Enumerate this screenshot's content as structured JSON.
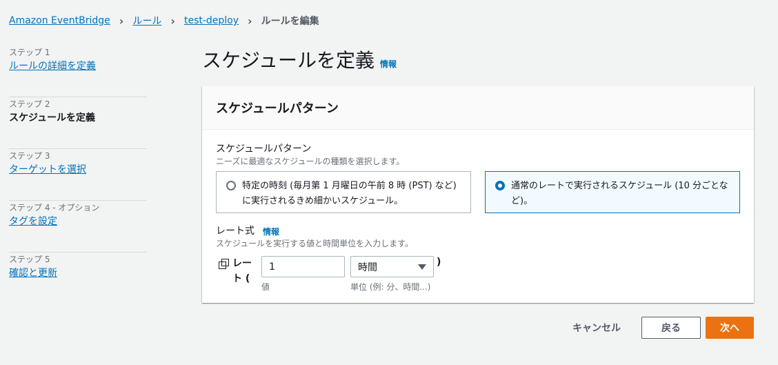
{
  "breadcrumb": {
    "items": [
      "Amazon EventBridge",
      "ルール",
      "test-deploy"
    ],
    "current": "ルールを編集"
  },
  "steps": [
    {
      "num": "ステップ 1",
      "title": "ルールの詳細を定義"
    },
    {
      "num": "ステップ 2",
      "title": "スケジュールを定義"
    },
    {
      "num": "ステップ 3",
      "title": "ターゲットを選択"
    },
    {
      "num": "ステップ 4 - オプション",
      "title": "タグを設定"
    },
    {
      "num": "ステップ 5",
      "title": "確認と更新"
    }
  ],
  "page": {
    "title": "スケジュールを定義",
    "info": "情報"
  },
  "card": {
    "header": "スケジュールパターン",
    "pattern_label": "スケジュールパターン",
    "pattern_desc": "ニーズに最適なスケジュールの種類を選択します。",
    "tiles": [
      {
        "text": "特定の時刻 (毎月第 1 月曜日の午前 8 時 (PST) など) に実行されるきめ細かいスケジュール。",
        "selected": false
      },
      {
        "text": "通常のレートで実行されるスケジュール (10 分ごとなど)。",
        "selected": true
      }
    ],
    "rate_label": "レート式",
    "rate_info": "情報",
    "rate_desc": "スケジュールを実行する値と時間単位を入力します。",
    "rate_prefix": "レート (",
    "rate_value": "1",
    "rate_value_hint": "値",
    "rate_unit": "時間",
    "rate_unit_hint": "単位 (例: 分、時間...)",
    "rate_suffix": ")"
  },
  "footer": {
    "cancel": "キャンセル",
    "back": "戻る",
    "next": "次へ"
  },
  "colors": {
    "link": "#0073bb",
    "primary": "#ec7211",
    "background": "#f2f3f3"
  }
}
